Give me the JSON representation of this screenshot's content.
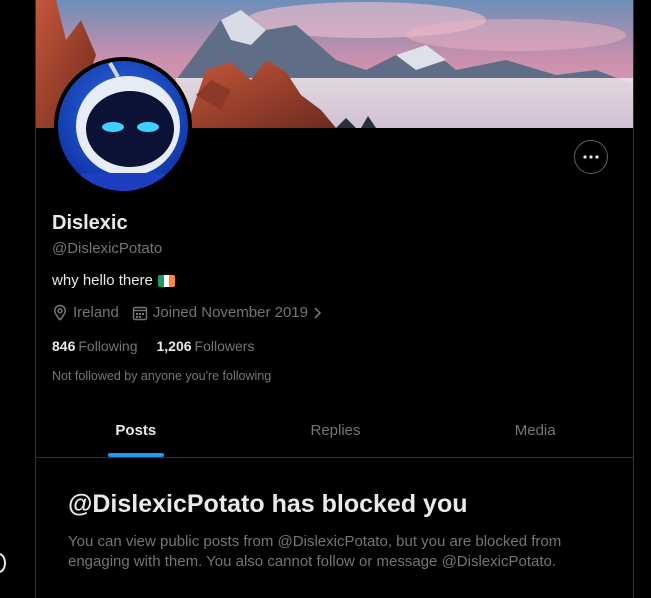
{
  "profile": {
    "name": "Dislexic",
    "handle": "@DislexicPotato",
    "bio": "why hello there",
    "location": "Ireland",
    "joined": "Joined November 2019",
    "following_count": "846",
    "following_label": "Following",
    "followers_count": "1,206",
    "followers_label": "Followers",
    "not_followed_text": "Not followed by anyone you're following"
  },
  "tabs": [
    {
      "label": "Posts",
      "active": true
    },
    {
      "label": "Replies",
      "active": false
    },
    {
      "label": "Media",
      "active": false
    }
  ],
  "blocked": {
    "title": "@DislexicPotato has blocked you",
    "description": "You can view public posts from @DislexicPotato, but you are blocked from engaging with them. You also cannot follow or message @DislexicPotato."
  },
  "icons": {
    "more": "more-horizontal-icon",
    "location": "location-pin-icon",
    "calendar": "calendar-icon",
    "chevron": "chevron-right-icon"
  },
  "colors": {
    "background": "#000000",
    "text_primary": "#e7e9ea",
    "text_secondary": "#71767b",
    "accent": "#1d9bf0",
    "border": "#2f3336",
    "flag_green": "#169b62",
    "flag_white": "#ffffff",
    "flag_orange": "#ff883e"
  }
}
